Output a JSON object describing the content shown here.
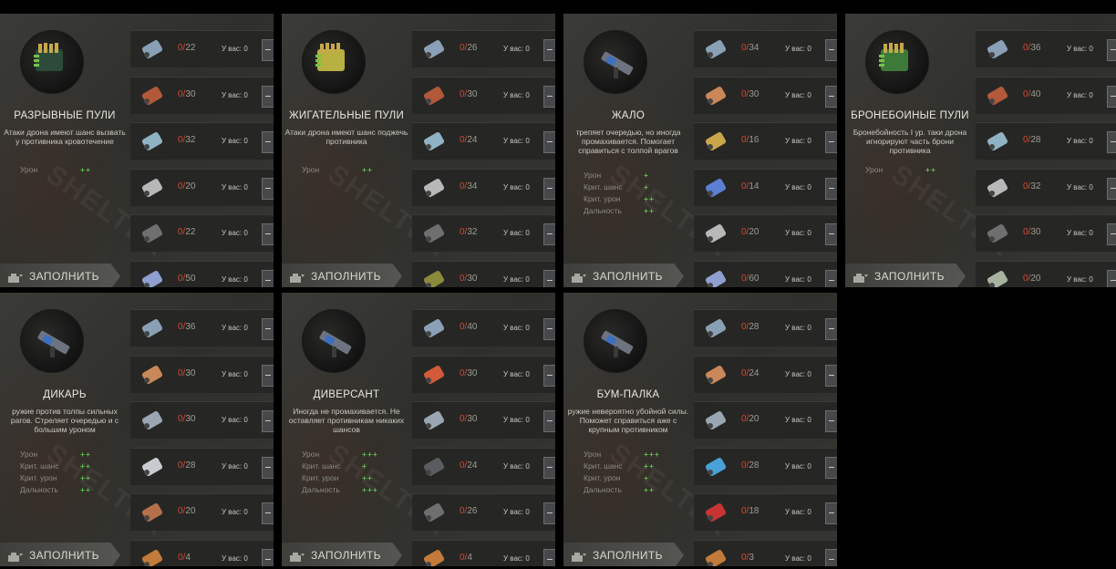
{
  "panels": [
    {
      "name": "РАЗРЫВНЫЕ ПУЛИ",
      "description": "Атаки дрона имеют шанс вызвать у противника кровотечение",
      "stats": [
        {
          "label": "Урон",
          "value": "++"
        }
      ],
      "fill_label": "ЗАПОЛНИТЬ",
      "icon": "exploding-bullets-box-icon",
      "resources": [
        {
          "icon": "syringe-icon",
          "need": "22",
          "have": "0"
        },
        {
          "icon": "wire-spool-icon",
          "need": "30",
          "have": "0"
        },
        {
          "icon": "glass-pane-icon",
          "need": "32",
          "have": "0"
        },
        {
          "icon": "metal-sheet-icon",
          "need": "20",
          "have": "0"
        },
        {
          "icon": "scrap-metal-icon",
          "need": "22",
          "have": "0"
        },
        {
          "icon": "scissors-icon",
          "need": "50",
          "have": "0"
        }
      ]
    },
    {
      "name": "ЖИГАТЕЛЬНЫЕ ПУЛИ",
      "description": "Атаки дрона имеют шанс поджечь противника",
      "stats": [
        {
          "label": "Урон",
          "value": "++"
        }
      ],
      "fill_label": "ЗАПОЛНИТЬ",
      "icon": "incendiary-bullets-box-icon",
      "resources": [
        {
          "icon": "syringe-icon",
          "need": "26",
          "have": "0"
        },
        {
          "icon": "wire-spool-icon",
          "need": "30",
          "have": "0"
        },
        {
          "icon": "glass-pane-icon",
          "need": "24",
          "have": "0"
        },
        {
          "icon": "metal-sheet-icon",
          "need": "34",
          "have": "0"
        },
        {
          "icon": "scrap-metal-icon",
          "need": "32",
          "have": "0"
        },
        {
          "icon": "jerry-can-icon",
          "need": "30",
          "have": "0"
        }
      ]
    },
    {
      "name": "ЖАЛО",
      "description": "трепяет очередью, но иногда промахивается. Помогает справиться с толпой врагов",
      "stats": [
        {
          "label": "Урон",
          "value": "+"
        },
        {
          "label": "Крит. шанс",
          "value": "+"
        },
        {
          "label": "Крит. урон",
          "value": "++"
        },
        {
          "label": "Дальность",
          "value": "++"
        }
      ],
      "fill_label": "ЗАПОЛНИТЬ",
      "icon": "stinger-gun-icon",
      "resources": [
        {
          "icon": "syringe-icon",
          "need": "34",
          "have": "0"
        },
        {
          "icon": "copper-coil-icon",
          "need": "30",
          "have": "0"
        },
        {
          "icon": "chain-icon",
          "need": "16",
          "have": "0"
        },
        {
          "icon": "circuit-board-icon",
          "need": "14",
          "have": "0"
        },
        {
          "icon": "metal-sheet-icon",
          "need": "20",
          "have": "0"
        },
        {
          "icon": "scissors-icon",
          "need": "60",
          "have": "0"
        }
      ]
    },
    {
      "name": "БРОНЕБОЙНЫЕ ПУЛИ",
      "description": "Бронебойность I ур. таки дрона игнорируют часть брони противника",
      "stats": [
        {
          "label": "Урон",
          "value": "++"
        }
      ],
      "fill_label": "ЗАПОЛНИТЬ",
      "icon": "armor-piercing-bullets-box-icon",
      "resources": [
        {
          "icon": "syringe-icon",
          "need": "36",
          "have": "0"
        },
        {
          "icon": "wire-spool-icon",
          "need": "40",
          "have": "0"
        },
        {
          "icon": "glass-pane-icon",
          "need": "28",
          "have": "0"
        },
        {
          "icon": "metal-sheet-icon",
          "need": "32",
          "have": "0"
        },
        {
          "icon": "scrap-metal-icon",
          "need": "30",
          "have": "0"
        },
        {
          "icon": "flask-icon",
          "need": "20",
          "have": "0"
        }
      ]
    },
    {
      "name": "ДИКАРЬ",
      "description": "ружие против толпы сильных рагов. Стреляет очередью и с большим уроном",
      "stats": [
        {
          "label": "Урон",
          "value": "++"
        },
        {
          "label": "Крит. шанс",
          "value": "++"
        },
        {
          "label": "Крит. урон",
          "value": "++"
        },
        {
          "label": "Дальность",
          "value": "++"
        }
      ],
      "fill_label": "ЗАПОЛНИТЬ",
      "icon": "savage-gun-icon",
      "resources": [
        {
          "icon": "syringe-icon",
          "need": "36",
          "have": "0"
        },
        {
          "icon": "copper-coil-icon",
          "need": "30",
          "have": "0"
        },
        {
          "icon": "bracket-icon",
          "need": "30",
          "have": "0"
        },
        {
          "icon": "rods-icon",
          "need": "28",
          "have": "0"
        },
        {
          "icon": "wood-plank-icon",
          "need": "20",
          "have": "0"
        },
        {
          "icon": "rifle-icon",
          "need": "4",
          "have": "0"
        }
      ]
    },
    {
      "name": "ДИВЕРСАНТ",
      "description": "Иногда не промахивается. Не оставляет противникам никаких шансов",
      "stats": [
        {
          "label": "Урон",
          "value": "+++"
        },
        {
          "label": "Крит. шанс",
          "value": "+"
        },
        {
          "label": "Крит. урон",
          "value": "++"
        },
        {
          "label": "Дальность",
          "value": "+++"
        }
      ],
      "fill_label": "ЗАПОЛНИТЬ",
      "icon": "saboteur-gun-icon",
      "resources": [
        {
          "icon": "syringe-icon",
          "need": "40",
          "have": "0"
        },
        {
          "icon": "magnet-icon",
          "need": "30",
          "have": "0"
        },
        {
          "icon": "bracket-icon",
          "need": "30",
          "have": "0"
        },
        {
          "icon": "bent-plate-icon",
          "need": "24",
          "have": "0"
        },
        {
          "icon": "scrap-metal-icon",
          "need": "26",
          "have": "0"
        },
        {
          "icon": "rifle-icon",
          "need": "4",
          "have": "0"
        }
      ]
    },
    {
      "name": "БУМ-ПАЛКА",
      "description": "ружие невероятно убойной силы. Поможет справиться аже с крупным противником",
      "stats": [
        {
          "label": "Урон",
          "value": "+++"
        },
        {
          "label": "Крит. шанс",
          "value": "++"
        },
        {
          "label": "Крит. урон",
          "value": "+"
        },
        {
          "label": "Дальность",
          "value": "++"
        }
      ],
      "fill_label": "ЗАПОЛНИТЬ",
      "icon": "boom-stick-gun-icon",
      "resources": [
        {
          "icon": "syringe-icon",
          "need": "28",
          "have": "0"
        },
        {
          "icon": "copper-coil-icon",
          "need": "24",
          "have": "0"
        },
        {
          "icon": "bracket-icon",
          "need": "20",
          "have": "0"
        },
        {
          "icon": "capacitors-icon",
          "need": "28",
          "have": "0"
        },
        {
          "icon": "gas-canister-icon",
          "need": "18",
          "have": "0"
        },
        {
          "icon": "rifle-icon",
          "need": "3",
          "have": "0"
        }
      ]
    }
  ],
  "labels": {
    "have_prefix": "У вас:",
    "need_prefix": "0/"
  }
}
